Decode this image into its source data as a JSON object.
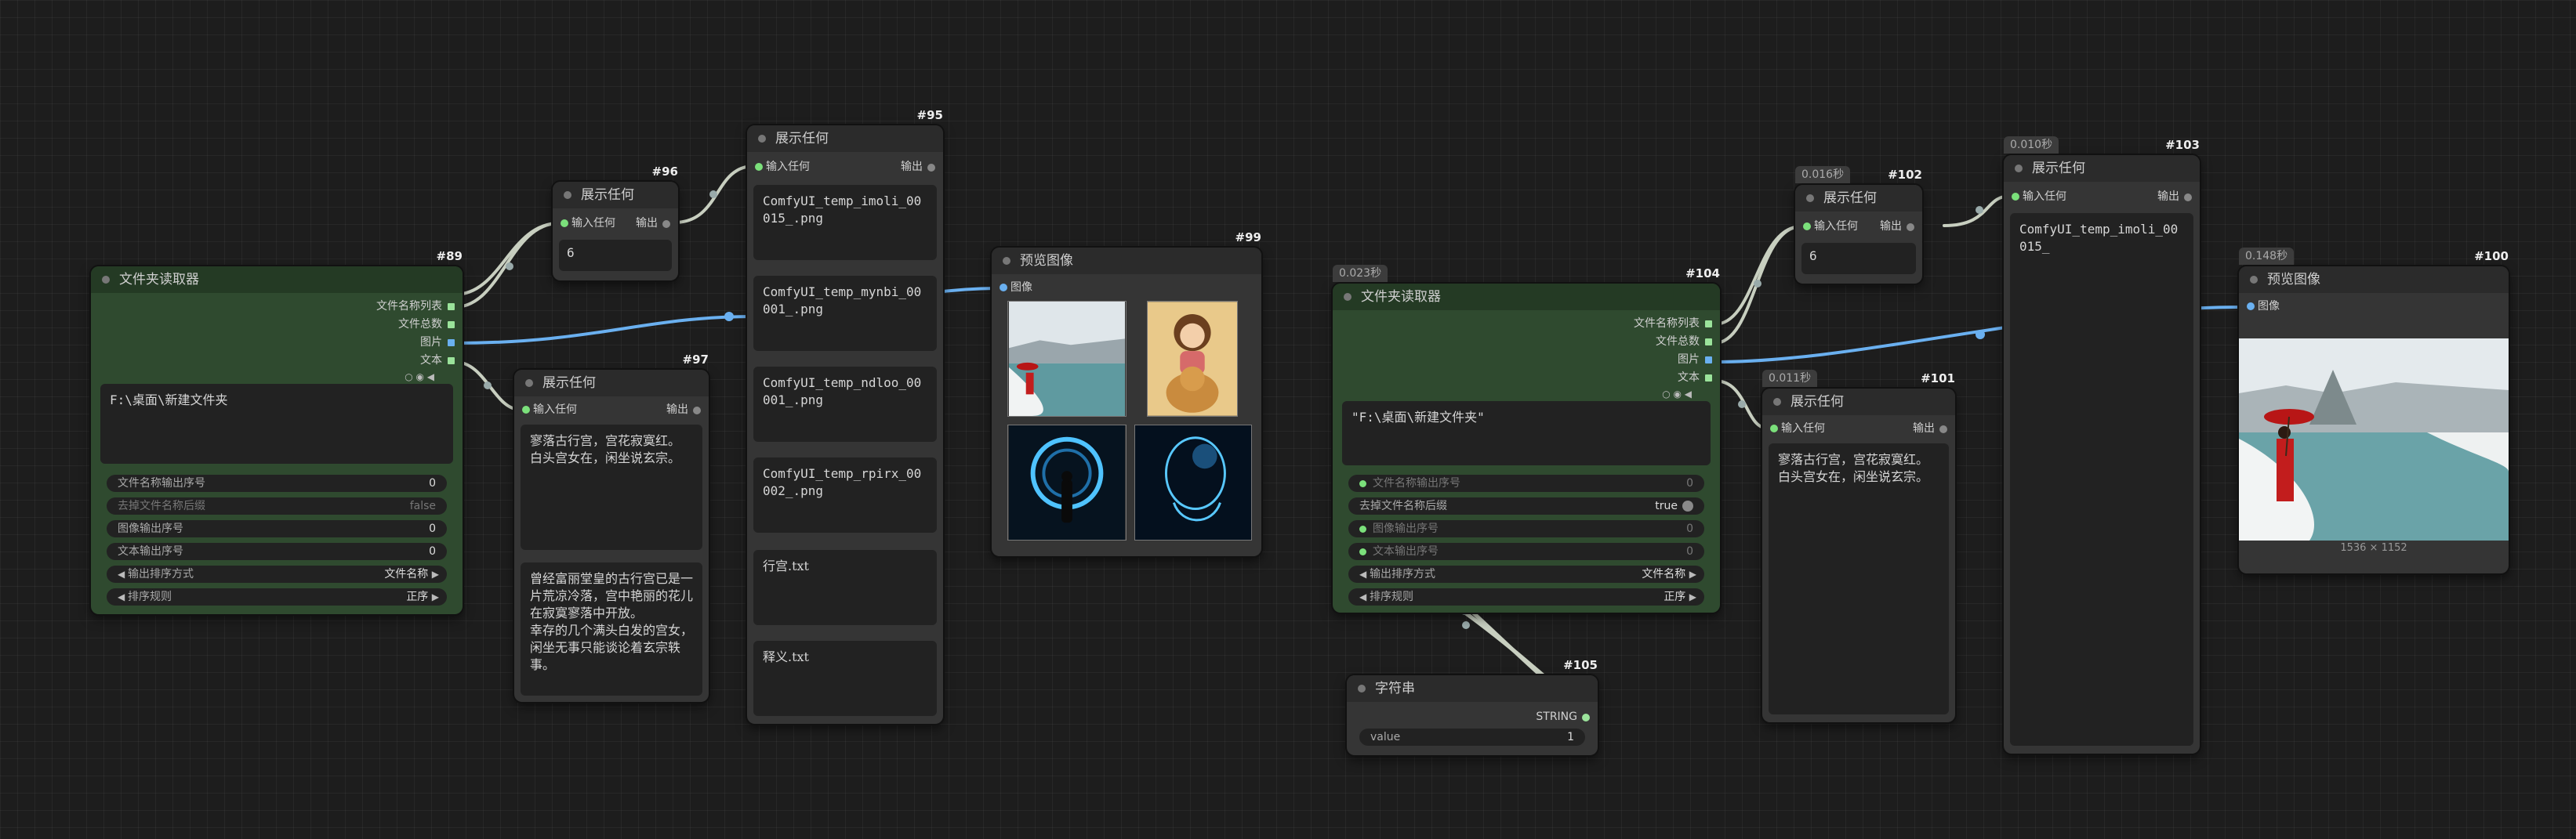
{
  "nodes": {
    "n89": {
      "id": "#89",
      "title": "文件夹读取器",
      "outputs": [
        "文件名称列表",
        "文件总数",
        "图片",
        "文本"
      ],
      "path": "F:\\桌面\\新建文件夹",
      "widgets": [
        {
          "label": "文件名称输出序号",
          "value": "0"
        },
        {
          "label": "去掉文件名称后缀",
          "value": "false"
        },
        {
          "label": "图像输出序号",
          "value": "0"
        },
        {
          "label": "文本输出序号",
          "value": "0"
        },
        {
          "label": "输出排序方式",
          "value": "文件名称"
        },
        {
          "label": "排序规则",
          "value": "正序"
        }
      ]
    },
    "n96": {
      "id": "#96",
      "title": "展示任何",
      "input": "输入任何",
      "output": "输出",
      "text": "6"
    },
    "n97": {
      "id": "#97",
      "title": "展示任何",
      "input": "输入任何",
      "output": "输出",
      "text1": "寥落古行宫，宫花寂寞红。\n白头宫女在，闲坐说玄宗。",
      "text2": "曾经富丽堂皇的古行宫已是一片荒凉冷落，宫中艳丽的花儿在寂寞寥落中开放。\n幸存的几个满头白发的宫女，闲坐无事只能谈论着玄宗轶事。"
    },
    "n95": {
      "id": "#95",
      "title": "展示任何",
      "input": "输入任何",
      "output": "输出",
      "texts": [
        "ComfyUI_temp_imoli_00015_.png",
        "ComfyUI_temp_mynbi_00001_.png",
        "ComfyUI_temp_ndloo_00001_.png",
        "ComfyUI_temp_rpirx_00002_.png",
        "行宫.txt",
        "释义.txt"
      ]
    },
    "n99": {
      "id": "#99",
      "title": "预览图像",
      "input": "图像"
    },
    "n104": {
      "id": "#104",
      "title": "文件夹读取器",
      "timing": "0.023秒",
      "outputs": [
        "文件名称列表",
        "文件总数",
        "图片",
        "文本"
      ],
      "path": "\"F:\\桌面\\新建文件夹\"",
      "widgets": [
        {
          "label": "文件名称输出序号",
          "value": "0"
        },
        {
          "label": "去掉文件名称后缀",
          "value": "true"
        },
        {
          "label": "图像输出序号",
          "value": "0"
        },
        {
          "label": "文本输出序号",
          "value": "0"
        },
        {
          "label": "输出排序方式",
          "value": "文件名称"
        },
        {
          "label": "排序规则",
          "value": "正序"
        }
      ]
    },
    "n105": {
      "id": "#105",
      "title": "字符串",
      "output": "STRING",
      "widget_label": "value",
      "widget_value": "1"
    },
    "n102": {
      "id": "#102",
      "title": "展示任何",
      "timing": "0.016秒",
      "input": "输入任何",
      "output": "输出",
      "text": "6"
    },
    "n101": {
      "id": "#101",
      "title": "展示任何",
      "timing": "0.011秒",
      "input": "输入任何",
      "output": "输出",
      "text": "寥落古行宫，宫花寂寞红。\n白头宫女在，闲坐说玄宗。"
    },
    "n103": {
      "id": "#103",
      "title": "展示任何",
      "timing": "0.010秒",
      "input": "输入任何",
      "output": "输出",
      "text": "ComfyUI_temp_imoli_00015_"
    },
    "n100": {
      "id": "#100",
      "title": "预览图像",
      "timing": "0.148秒",
      "input": "图像",
      "caption": "1536 × 1152"
    }
  },
  "colors": {
    "canvas": "#1d1d1d",
    "node": "#353535",
    "node_green": "#2f4a2f",
    "link_image": "#6ab0f0",
    "link_generic": "#c8cfc0"
  }
}
